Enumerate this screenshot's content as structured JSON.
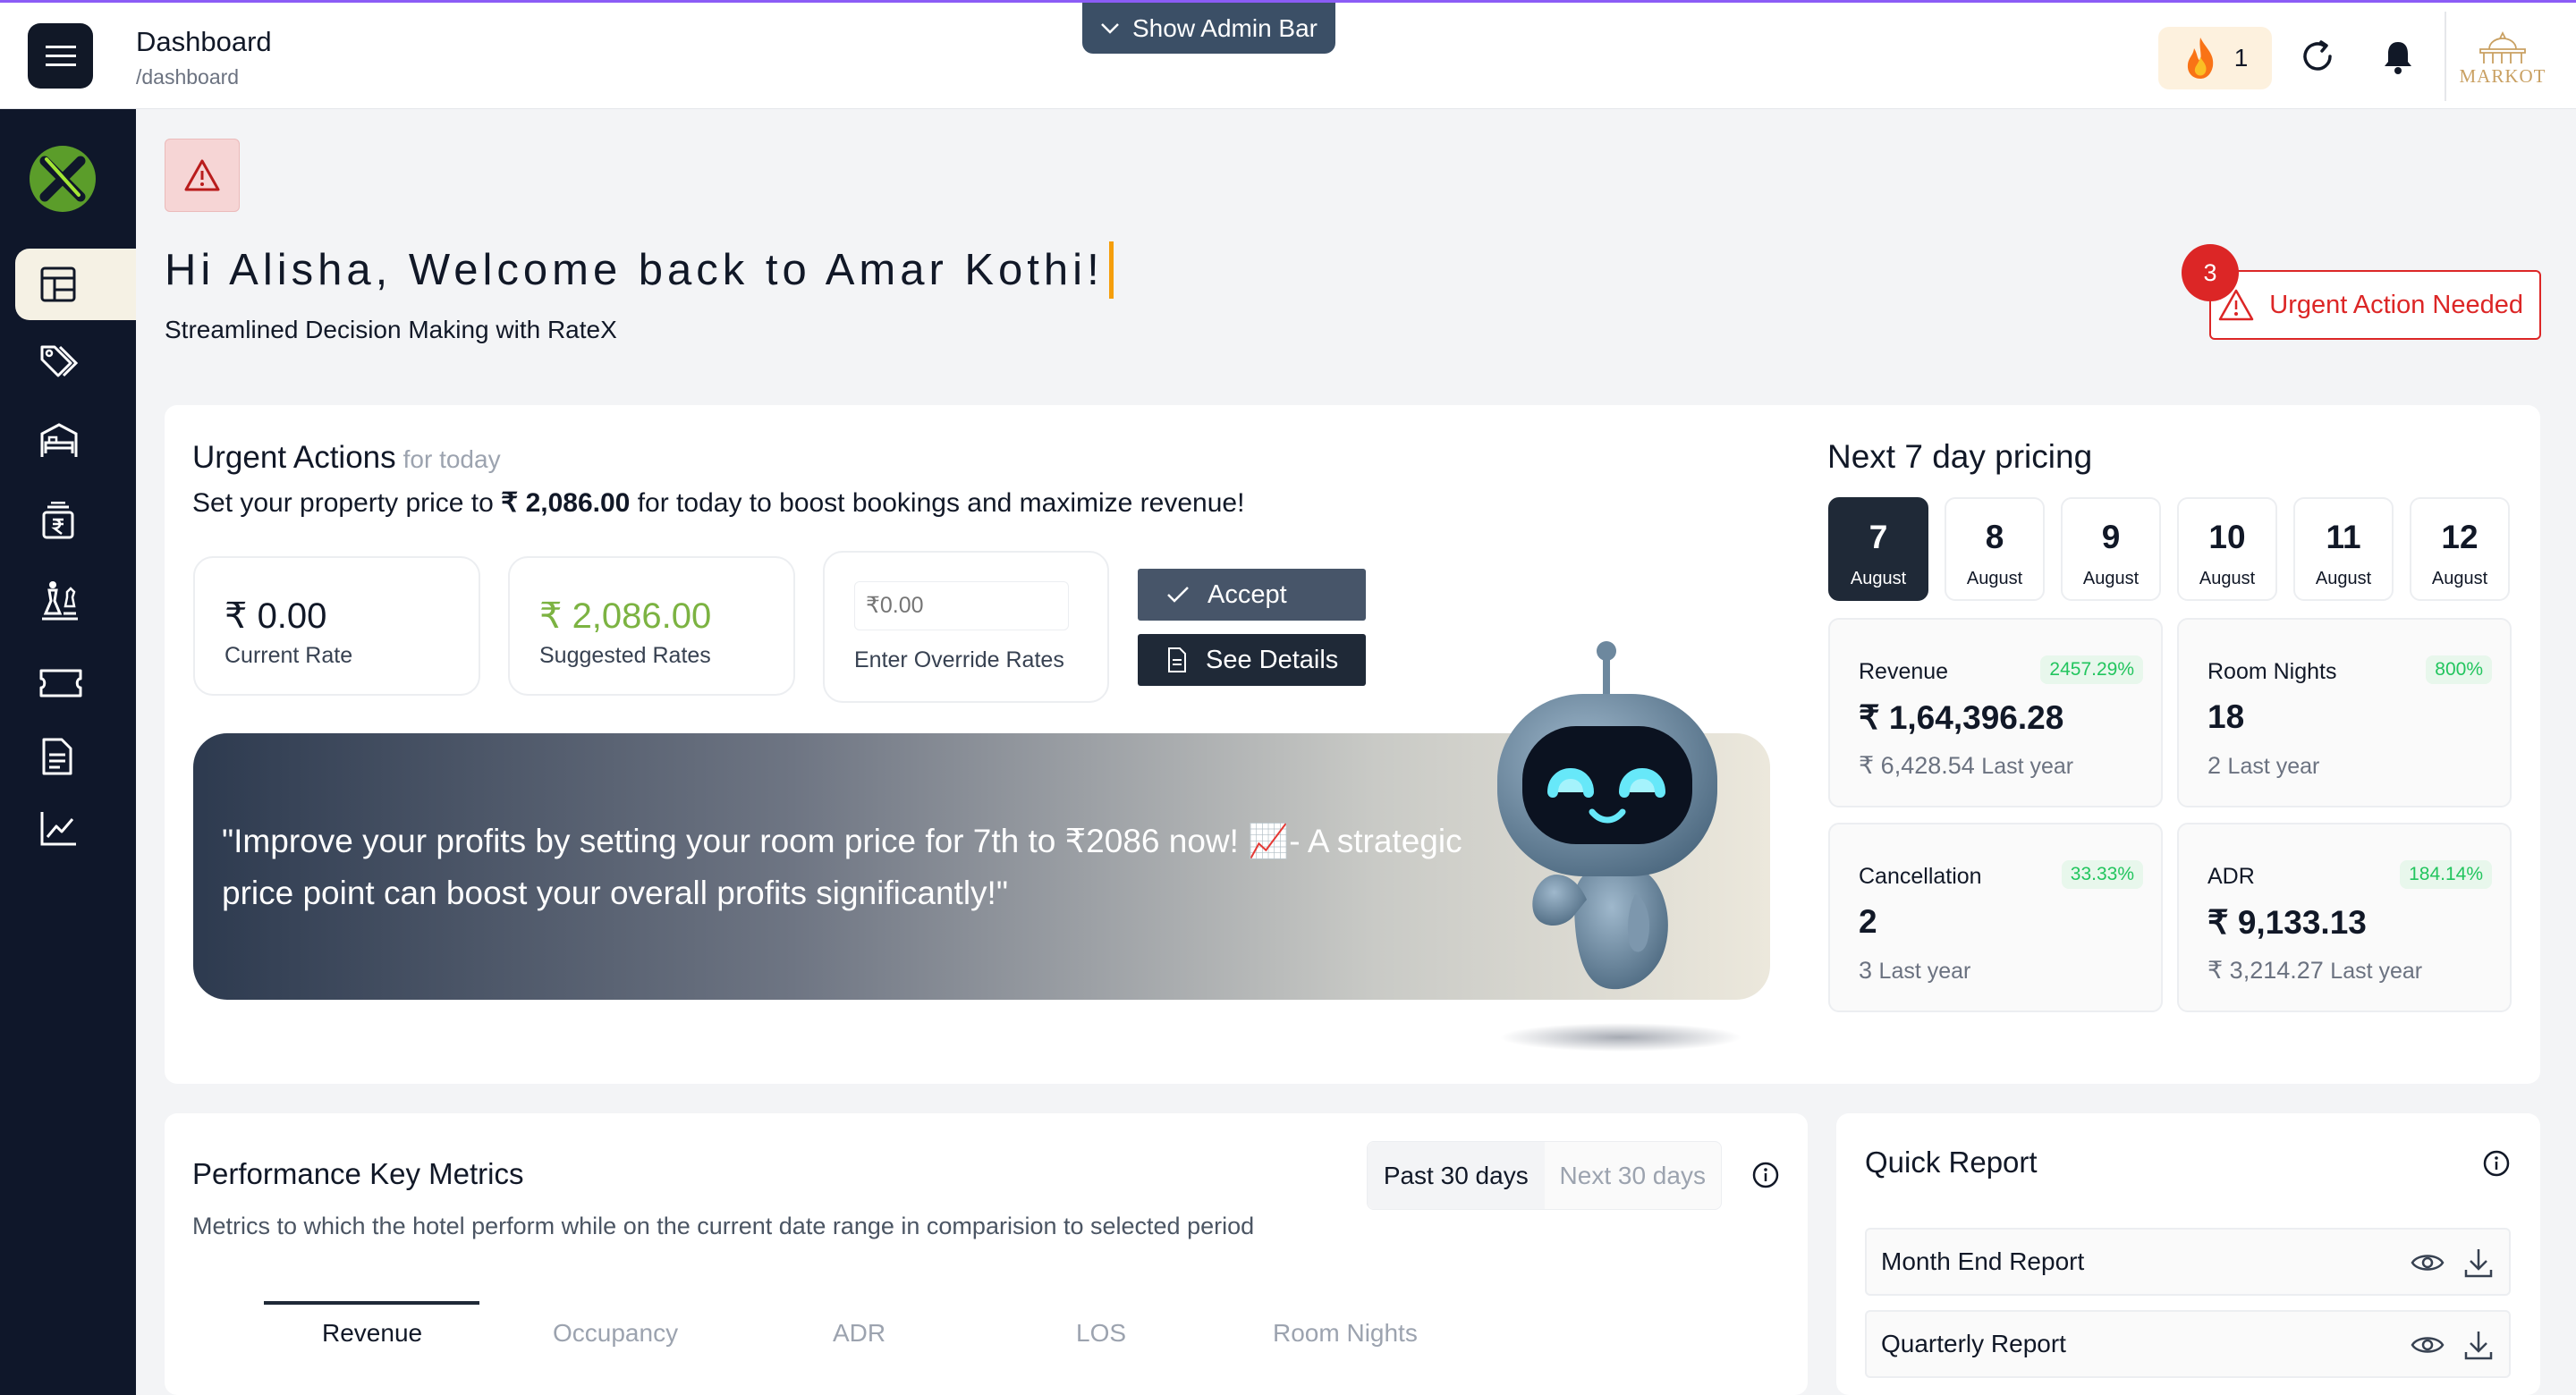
{
  "header": {
    "title": "Dashboard",
    "path": "/dashboard",
    "admin_bar_label": "Show Admin Bar",
    "streak_count": "1",
    "brand_text": "MARKOT"
  },
  "sidebar": {
    "items": [
      {
        "name": "dashboard",
        "icon": "layout-icon",
        "active": true
      },
      {
        "name": "pricing",
        "icon": "tags-icon"
      },
      {
        "name": "rooms",
        "icon": "bed-icon"
      },
      {
        "name": "rates",
        "icon": "rupee-stack-icon"
      },
      {
        "name": "competitors",
        "icon": "chess-icon"
      },
      {
        "name": "tickets",
        "icon": "ticket-icon"
      },
      {
        "name": "reports",
        "icon": "document-icon"
      },
      {
        "name": "analytics",
        "icon": "trend-icon"
      }
    ]
  },
  "welcome": {
    "heading": "Hi Alisha, Welcome back to Amar Kothi!",
    "subheading": "Streamlined Decision Making with RateX",
    "urgent_label": "Urgent Action Needed",
    "urgent_count": "3"
  },
  "urgent_actions": {
    "title": "Urgent Actions",
    "title_suffix": "for today",
    "line_prefix": "Set your property price to ",
    "line_price": "₹ 2,086.00",
    "line_suffix": " for today to boost bookings and maximize revenue!",
    "current_rate_value": "₹ 0.00",
    "current_rate_label": "Current Rate",
    "suggested_rate_value": "₹ 2,086.00",
    "suggested_rate_label": "Suggested Rates",
    "override_placeholder": "₹0.00",
    "override_label": "Enter Override Rates",
    "accept_label": "Accept",
    "details_label": "See Details",
    "banner_text": "\"Improve your profits by setting your room price for 7th to ₹2086 now! 📈- A strategic price point can boost your overall profits significantly!\""
  },
  "next7": {
    "title": "Next 7 day pricing",
    "days": [
      {
        "num": "7",
        "month": "August",
        "active": true
      },
      {
        "num": "8",
        "month": "August"
      },
      {
        "num": "9",
        "month": "August"
      },
      {
        "num": "10",
        "month": "August"
      },
      {
        "num": "11",
        "month": "August"
      },
      {
        "num": "12",
        "month": "August"
      }
    ],
    "stats": [
      {
        "label": "Revenue",
        "pct": "2457.29%",
        "value": "₹ 1,64,396.28",
        "last_value": "₹ 6,428.54",
        "last_label": "Last year"
      },
      {
        "label": "Room Nights",
        "pct": "800%",
        "value": "18",
        "last_value": "2",
        "last_label": "Last year"
      },
      {
        "label": "Cancellation",
        "pct": "33.33%",
        "value": "2",
        "last_value": "3",
        "last_label": "Last year"
      },
      {
        "label": "ADR",
        "pct": "184.14%",
        "value": "₹ 9,133.13",
        "last_value": "₹ 3,214.27",
        "last_label": "Last year"
      }
    ]
  },
  "performance": {
    "title": "Performance Key Metrics",
    "description": "Metrics to which the hotel perform while on the current date range in comparision to selected period",
    "range_options": [
      "Past 30 days",
      "Next 30 days"
    ],
    "tabs": [
      "Revenue",
      "Occupancy",
      "ADR",
      "LOS",
      "Room Nights"
    ]
  },
  "quick_report": {
    "title": "Quick Report",
    "items": [
      "Month End Report",
      "Quarterly Report"
    ]
  },
  "colors": {
    "sidebar_bg": "#0f172a",
    "danger": "#dc2626",
    "success": "#22c55e",
    "suggested_green": "#7cb342",
    "accent_bar": "#8b5cf6"
  }
}
